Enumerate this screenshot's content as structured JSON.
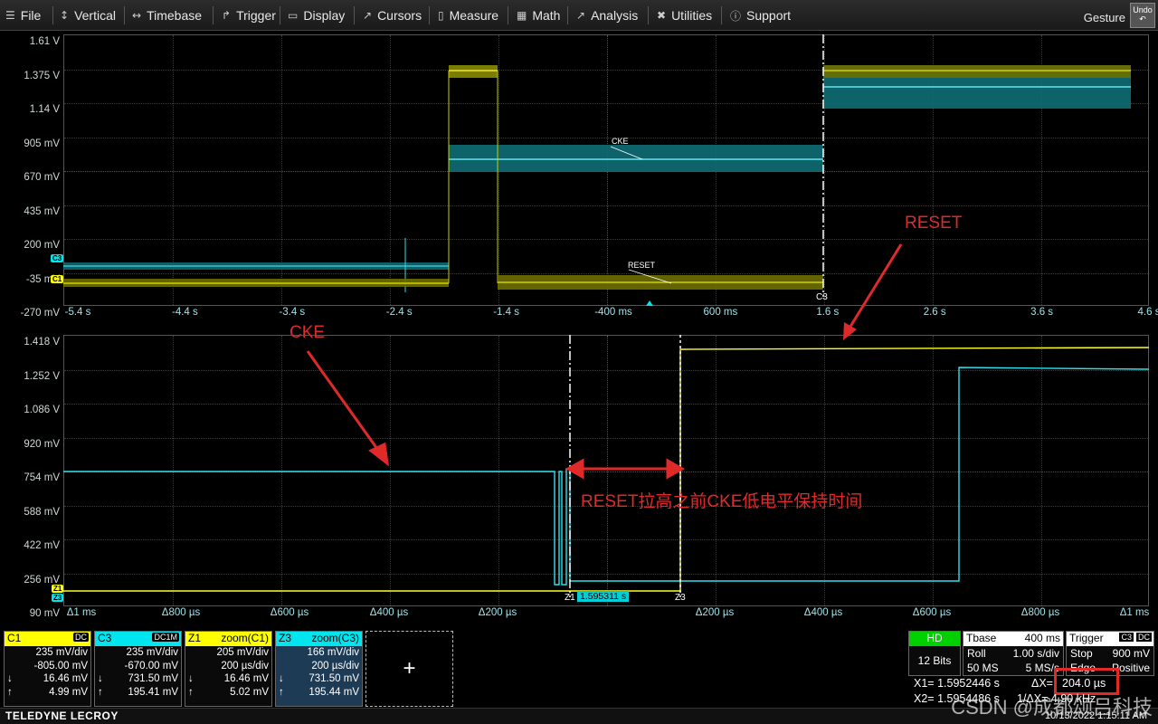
{
  "menu": {
    "items": [
      {
        "label": "File",
        "icon": "☰"
      },
      {
        "label": "Vertical",
        "icon": "↕"
      },
      {
        "label": "Timebase",
        "icon": "↔"
      },
      {
        "label": "Trigger",
        "icon": "↱"
      },
      {
        "label": "Display",
        "icon": "▭"
      },
      {
        "label": "Cursors",
        "icon": "↗"
      },
      {
        "label": "Measure",
        "icon": "▯"
      },
      {
        "label": "Math",
        "icon": "▦"
      },
      {
        "label": "Analysis",
        "icon": "↗"
      },
      {
        "label": "Utilities",
        "icon": "✖"
      },
      {
        "label": "Support",
        "icon": "ⓘ"
      }
    ],
    "gesture_label": "Gesture",
    "undo_label": "Undo"
  },
  "top_grid": {
    "y_labels": [
      "1.61 V",
      "1.375 V",
      "1.14 V",
      "905 mV",
      "670 mV",
      "435 mV",
      "200 mV",
      "-35 mV",
      "-270 mV"
    ],
    "x_labels": [
      "-5.4 s",
      "-4.4 s",
      "-3.4 s",
      "-2.4 s",
      "-1.4 s",
      "-400 ms",
      "600 ms",
      "1.6 s",
      "2.6 s",
      "3.6 s",
      "4.6 s"
    ],
    "trace_labels": {
      "cke": "CKE",
      "reset": "RESET"
    },
    "channel_tags": {
      "c3": "C3",
      "c1": "C1"
    },
    "cursor_tag": "C3"
  },
  "bottom_grid": {
    "y_labels": [
      "1.418 V",
      "1.252 V",
      "1.086 V",
      "920 mV",
      "754 mV",
      "588 mV",
      "422 mV",
      "256 mV",
      "90 mV"
    ],
    "x_labels": [
      "Δ1 ms",
      "Δ800 µs",
      "Δ600 µs",
      "Δ400 µs",
      "Δ200 µs",
      "Δ200 µs",
      "Δ400 µs",
      "Δ600 µs",
      "Δ800 µs",
      "Δ1 ms"
    ],
    "channel_tags": {
      "z1": "Z1",
      "z3": "Z3"
    },
    "cursor_value": "1.595311 s",
    "cursor_tags": {
      "x1": "Z1",
      "x2": "Z3"
    }
  },
  "annotations": {
    "reset": "RESET",
    "cke": "CKE",
    "note": "RESET拉高之前CKE低电平保持时间"
  },
  "channels": [
    {
      "name": "C1",
      "tag": "DC",
      "color": "#ffff00",
      "vdiv": "235 mV/div",
      "offset": "-805.00 mV",
      "v1": "16.46 mV",
      "v2": "4.99 mV"
    },
    {
      "name": "C3",
      "tag": "DC1M",
      "color": "#00e5ee",
      "vdiv": "235 mV/div",
      "offset": "-670.00 mV",
      "v1": "731.50 mV",
      "v2": "195.41 mV"
    },
    {
      "name": "Z1",
      "tag": "zoom(C1)",
      "color": "#ffff00",
      "vdiv": "205 mV/div",
      "offset": "200 µs/div",
      "v1": "16.46 mV",
      "v2": "5.02 mV"
    },
    {
      "name": "Z3",
      "tag": "zoom(C3)",
      "color": "#00e5ee",
      "vdiv": "166 mV/div",
      "offset": "200 µs/div",
      "v1": "731.50 mV",
      "v2": "195.44 mV"
    }
  ],
  "add_button": "+",
  "hd": {
    "label": "HD",
    "bits": "12 Bits"
  },
  "timebase": {
    "label": "Tbase",
    "value": "400 ms",
    "mode": "Roll",
    "sdiv": "1.00 s/div",
    "rate": "50 MS",
    "srate": "5 MS/s"
  },
  "trigger": {
    "label": "Trigger",
    "tag1": "C3",
    "tag2": "DC",
    "state": "Stop",
    "level": "900 mV",
    "type": "Edge",
    "slope": "Positive"
  },
  "cursors": {
    "x1_label": "X1=",
    "x1": "1.5952446 s",
    "x2_label": "X2=",
    "x2": "1.5954486 s",
    "dx_label": "ΔX=",
    "dx": "204.0 µs",
    "dy_label": "1/ΔX=",
    "dy": "4.90 kHz"
  },
  "footer": {
    "brand": "TELEDYNE LECROY",
    "datetime": "10/13/2022 1:15:11 AM"
  },
  "watermark": "CSDN @成都颂吕科技",
  "colors": {
    "c1": "#ffff00",
    "c3": "#00e5ee",
    "annotation": "#e02a2a"
  }
}
